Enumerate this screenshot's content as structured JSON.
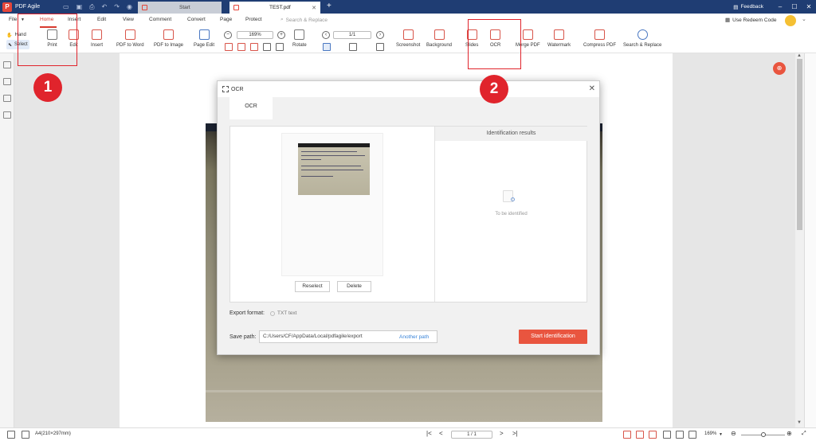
{
  "titlebar": {
    "app_name": "PDF Agile",
    "tabs": [
      {
        "label": "Start"
      },
      {
        "label": "TEST.pdf"
      }
    ],
    "feedback": "Feedback"
  },
  "menu": {
    "items": [
      "File",
      "Home",
      "Insert",
      "Edit",
      "View",
      "Comment",
      "Convert",
      "Page",
      "Protect"
    ],
    "active": "Home",
    "search_placeholder": "Search & Replace",
    "redeem": "Use Redeem Code"
  },
  "toolbar": {
    "hand": "Hand",
    "select": "Select",
    "print": "Print",
    "edit": "Edit",
    "insert": "Insert",
    "pdf_to_word": "PDF to Word",
    "pdf_to_image": "PDF to Image",
    "page_edit": "Page Edit",
    "zoom": "169%",
    "rotate": "Rotate",
    "page": "1/1",
    "screenshot": "Screenshot",
    "background": "Background",
    "slides": "Slides",
    "ocr": "OCR",
    "merge_pdf": "Merge PDF",
    "watermark": "Watermark",
    "compress_pdf": "Compress PDF",
    "search_replace": "Search & Replace"
  },
  "annotations": {
    "marker1": "1",
    "marker2": "2",
    "color": "#e0242c"
  },
  "dialog": {
    "title": "OCR",
    "tab": "OCR",
    "reselect": "Reselect",
    "delete": "Delete",
    "results_header": "Identification results",
    "results_empty": "To be identified",
    "export_format_label": "Export format:",
    "export_format_value": "TXT text",
    "save_path_label": "Save path:",
    "save_path_value": "C:/Users/CF/AppData/Local/pdfagile/export",
    "another_path": "Another path",
    "start_button": "Start identification"
  },
  "statusbar": {
    "page_size": "A4(210×297mm)",
    "page_indicator": "1 / 1",
    "zoom": "169%"
  },
  "colors": {
    "brand": "#e9553f",
    "titlebar": "#1f3d73",
    "link": "#3a84d8"
  }
}
